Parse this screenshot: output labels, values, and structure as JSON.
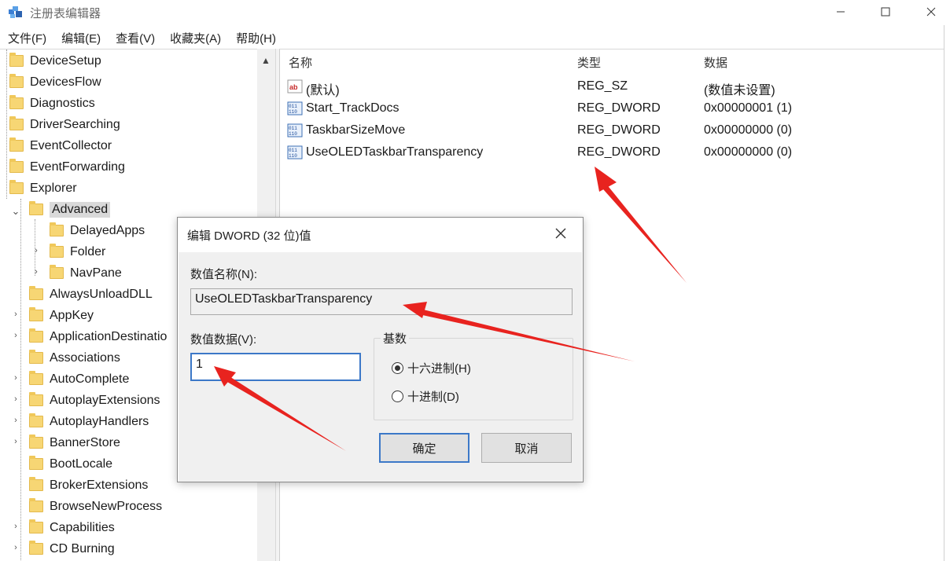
{
  "window": {
    "title": "注册表编辑器",
    "controls": {
      "minimize": "—",
      "maximize": "☐",
      "close": "✕"
    }
  },
  "menu": [
    "文件(F)",
    "编辑(E)",
    "查看(V)",
    "收藏夹(A)",
    "帮助(H)"
  ],
  "tree": {
    "items": [
      {
        "label": "DeviceSetup"
      },
      {
        "label": "DevicesFlow"
      },
      {
        "label": "Diagnostics"
      },
      {
        "label": "DriverSearching"
      },
      {
        "label": "EventCollector"
      },
      {
        "label": "EventForwarding"
      },
      {
        "label": "Explorer"
      },
      {
        "label": "Advanced",
        "expanded": true,
        "selected": true
      },
      {
        "label": "DelayedApps"
      },
      {
        "label": "Folder",
        "collapsed": true
      },
      {
        "label": "NavPane",
        "collapsed": true
      },
      {
        "label": "AlwaysUnloadDLL"
      },
      {
        "label": "AppKey",
        "collapsed": true
      },
      {
        "label": "ApplicationDestinatio",
        "collapsed": true
      },
      {
        "label": "Associations"
      },
      {
        "label": "AutoComplete",
        "collapsed": true
      },
      {
        "label": "AutoplayExtensions",
        "collapsed": true
      },
      {
        "label": "AutoplayHandlers",
        "collapsed": true
      },
      {
        "label": "BannerStore",
        "collapsed": true
      },
      {
        "label": "BootLocale"
      },
      {
        "label": "BrokerExtensions"
      },
      {
        "label": "BrowseNewProcess"
      },
      {
        "label": "Capabilities",
        "collapsed": true
      },
      {
        "label": "CD Burning",
        "collapsed": true
      }
    ]
  },
  "list": {
    "columns": [
      "名称",
      "类型",
      "数据"
    ],
    "rows": [
      {
        "name": "(默认)",
        "type": "REG_SZ",
        "data": "(数值未设置)",
        "icon": "string-value-icon"
      },
      {
        "name": "Start_TrackDocs",
        "type": "REG_DWORD",
        "data": "0x00000001 (1)",
        "icon": "binary-value-icon"
      },
      {
        "name": "TaskbarSizeMove",
        "type": "REG_DWORD",
        "data": "0x00000000 (0)",
        "icon": "binary-value-icon"
      },
      {
        "name": "UseOLEDTaskbarTransparency",
        "type": "REG_DWORD",
        "data": "0x00000000 (0)",
        "icon": "binary-value-icon"
      }
    ]
  },
  "dialog": {
    "title": "编辑 DWORD (32 位)值",
    "name_label": "数值名称(N):",
    "name_value": "UseOLEDTaskbarTransparency",
    "data_label": "数值数据(V):",
    "data_value": "1",
    "base_label": "基数",
    "base_hex": "十六进制(H)",
    "base_dec": "十进制(D)",
    "base_selected": "hex",
    "ok": "确定",
    "cancel": "取消"
  },
  "colors": {
    "arrow": "#e8231f",
    "focus": "#3c78c8",
    "folder": "#f7d674"
  }
}
